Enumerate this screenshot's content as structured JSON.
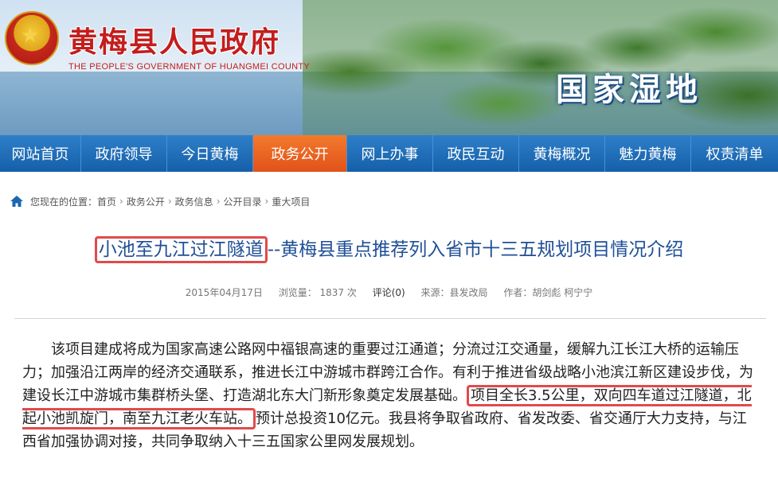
{
  "header": {
    "site_title": "黄梅县人民政府",
    "site_subtitle": "THE PEOPLE'S GOVERNMENT OF HUANGMEI COUNTY",
    "slogan": "国家湿地"
  },
  "nav": {
    "items": [
      "网站首页",
      "政府领导",
      "今日黄梅",
      "政务公开",
      "网上办事",
      "政民互动",
      "黄梅概况",
      "魅力黄梅",
      "权责清单"
    ],
    "active_index": 3
  },
  "breadcrumb": {
    "prefix": "您现在的位置：",
    "items": [
      "首页",
      "政务公开",
      "政务信息",
      "公开目录",
      "重大项目"
    ]
  },
  "article": {
    "title_highlight": "小池至九江过江隧道",
    "title_rest": "--黄梅县重点推荐列入省市十三五规划项目情况介绍",
    "date": "2015年04月17日",
    "views": "浏览量： 1837 次",
    "comments": "评论(0)",
    "source": "来源：县发改局",
    "author": "作者：胡剑彪 柯宁宁",
    "body_part1": "该项目建成将成为国家高速公路网中福银高速的重要过江通道；分流过江交通量，缓解九江长江大桥的运输压力；加强沿江两岸的经济交通联系，推进长江中游城市群跨江合作。有利于推进省级战略小池滨江新区建设步伐，为建设长江中游城市集群桥头堡、打造湖北东大门新形象奠定发展基础。",
    "body_highlight": "项目全长3.5公里，双向四车道过江隧道，北起小池凯旋门，南至九江老火车站。",
    "body_part2": "预计总投资10亿元。我县将争取省政府、省发改委、省交通厅大力支持，与江西省加强协调对接，共同争取纳入十三五国家公里网发展规划。"
  },
  "colors": {
    "nav_bg": "#1b66b1",
    "nav_active": "#e95d22",
    "title_color": "#1f4f97",
    "highlight_border": "#e14a4a",
    "site_title_color": "#c31d1d"
  },
  "icons": {
    "breadcrumb": "home-icon",
    "emblem": "national-emblem-icon"
  }
}
